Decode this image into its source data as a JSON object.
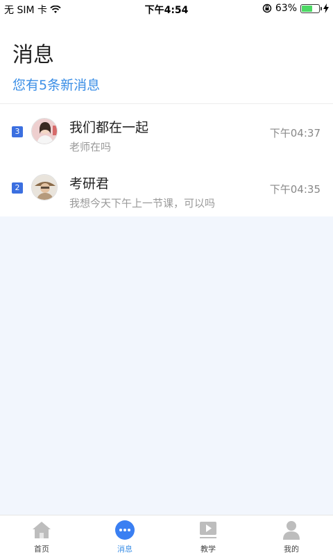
{
  "status_bar": {
    "carrier": "无 SIM 卡",
    "time": "下午4:54",
    "battery": "63%",
    "battery_level": 0.63
  },
  "header": {
    "title": "消息",
    "subtitle": "您有5条新消息"
  },
  "messages": [
    {
      "badge": "3",
      "title": "我们都在一起",
      "preview": "老师在吗",
      "time": "下午04:37",
      "avatar": "teacher-avatar"
    },
    {
      "badge": "2",
      "title": "考研君",
      "preview": "我想今天下午上一节课，可以吗",
      "time": "下午04:35",
      "avatar": "user-avatar"
    }
  ],
  "tabs": [
    {
      "label": "首页",
      "icon": "home-icon"
    },
    {
      "label": "消息",
      "icon": "message-icon",
      "active": true
    },
    {
      "label": "教学",
      "icon": "play-icon"
    },
    {
      "label": "我的",
      "icon": "user-icon"
    }
  ],
  "colors": {
    "accent": "#3a8ee6",
    "badge": "#3b6fe0",
    "background": "#f2f6fd"
  }
}
